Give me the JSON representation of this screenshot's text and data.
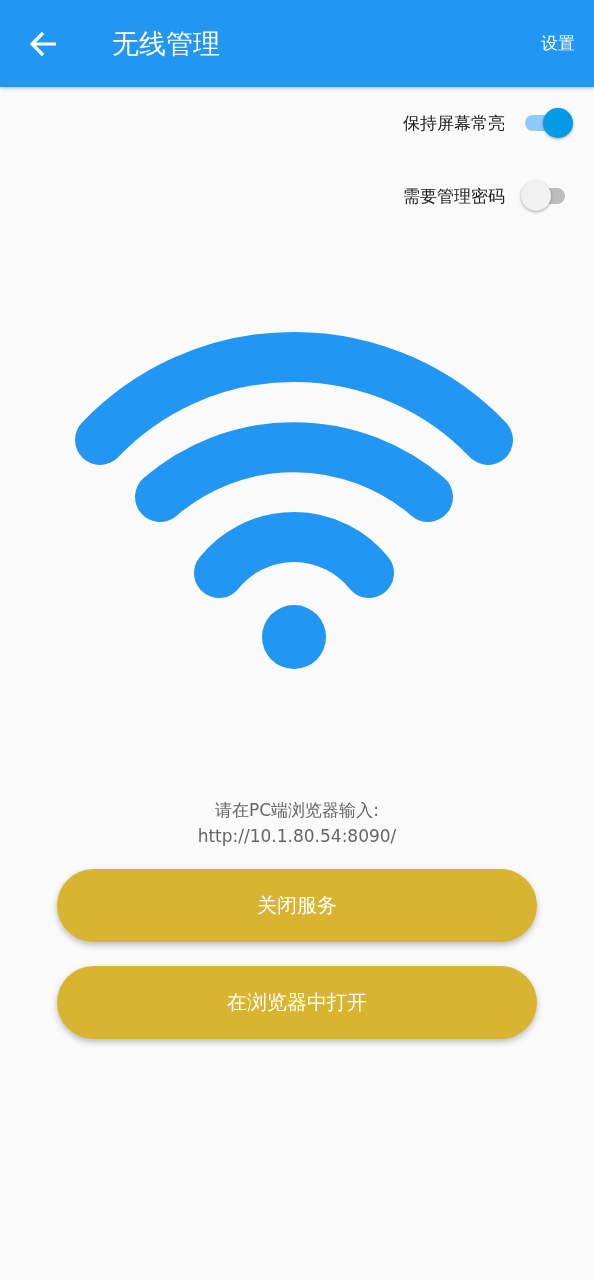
{
  "app_bar": {
    "title": "无线管理",
    "action": "设置"
  },
  "switches": [
    {
      "label": "保持屏幕常亮",
      "on": true
    },
    {
      "label": "需要管理密码",
      "on": false
    }
  ],
  "instructions": [
    "请在PC端浏览器输入:",
    "http://10.1.80.54:8090/"
  ],
  "buttons": [
    "关闭服务",
    "在浏览器中打开"
  ]
}
